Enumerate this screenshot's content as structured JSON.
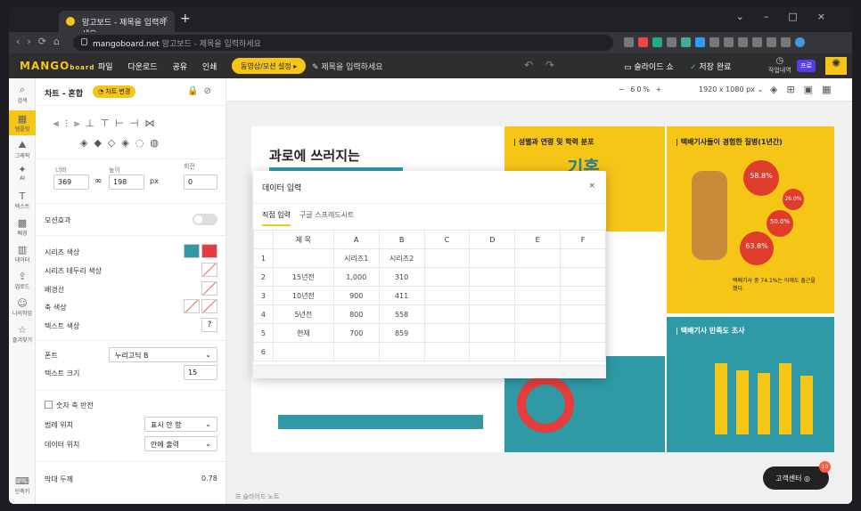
{
  "browser": {
    "tab_title": "망고보드 - 제목을 입력하세요",
    "url_host": "mangoboard.net",
    "url_rest": "망고보드 - 제목을 입력하세요"
  },
  "app": {
    "logo": "MANGO",
    "logo_sub": "board",
    "menus": [
      "파일",
      "다운로드",
      "공유",
      "인쇄"
    ],
    "video_pill": "동영상/모션 설정 ▸",
    "doc_title_placeholder": "제목을 입력하세요",
    "slideshow": "슬라이드 쇼",
    "save_status": "저장 완료",
    "history": "작업내역",
    "pro": "프로"
  },
  "rail": [
    {
      "icon": "⌕",
      "label": "검색"
    },
    {
      "icon": "▦",
      "label": "템플릿"
    },
    {
      "icon": "⛰",
      "label": "그래픽"
    },
    {
      "icon": "✦",
      "label": "AI"
    },
    {
      "icon": "T",
      "label": "텍스트"
    },
    {
      "icon": "▩",
      "label": "배경"
    },
    {
      "icon": "▥",
      "label": "데이터"
    },
    {
      "icon": "⇪",
      "label": "업로드"
    },
    {
      "icon": "☺",
      "label": "나의작업"
    },
    {
      "icon": "☆",
      "label": "즐겨찾기"
    },
    {
      "icon": "⌨",
      "label": "단축키"
    }
  ],
  "panel": {
    "title": "차트 - 혼합",
    "change_chart": "차트 변경",
    "width_label": "너비",
    "width": "369",
    "height_label": "높이",
    "height": "198",
    "unit": "px",
    "rotate_label": "회전",
    "rotate": "0",
    "motion": "모션효과",
    "series_color": "시리즈 색상",
    "series_border": "시리즈 테두리 색상",
    "bg_color": "배경선",
    "axis_color": "축 색상",
    "text_color": "텍스트 색상",
    "font_label": "폰트",
    "font_value": "누리고딕 B",
    "text_size_label": "텍스트 크기",
    "text_size": "15",
    "swap_axis": "숫자 축 반전",
    "legend_pos_label": "범례 위치",
    "legend_pos": "표시 안 함",
    "data_pos_label": "데이터 위치",
    "data_pos": "안에 출력",
    "bar_thickness_label": "막대 두께",
    "bar_thickness": "0.78",
    "colors": {
      "series1": "#2f9aa6",
      "series2": "#e63c3c"
    }
  },
  "workspace": {
    "zoom": "60%",
    "canvas_size": "1920 x 1080 px",
    "notes": "슬라이드 노트"
  },
  "slide": {
    "title_line": "과로에 쓰러지는",
    "block1_title": "| 성별과 연령 및 학력 분포",
    "block1_big": "기혼",
    "block2_title": "| 택배기사들이 경험한 질병(1년간)",
    "stat1": "58.8%",
    "stat2": "26.0%",
    "stat3": "50.0%",
    "stat4": "63.8%",
    "block2_caption": "택배기사 중 74.1%는 어깨도 출근을 했다.",
    "block3_title": "| 택배기사 만족도 조사",
    "bars": [
      "2.88",
      "2.58",
      "2.48",
      "2.88",
      "2.38"
    ]
  },
  "dialog": {
    "title": "데이터 입력",
    "close": "×",
    "tab_direct": "직접 입력",
    "tab_sheet": "구글 스프레드시트",
    "columns": [
      "",
      "제 목",
      "A",
      "B",
      "C",
      "D",
      "E",
      "F"
    ],
    "rows": [
      [
        "1",
        "",
        "시리즈1",
        "시리즈2",
        "",
        "",
        "",
        ""
      ],
      [
        "2",
        "15년전",
        "1,000",
        "310",
        "",
        "",
        "",
        ""
      ],
      [
        "3",
        "10년전",
        "900",
        "411",
        "",
        "",
        "",
        ""
      ],
      [
        "4",
        "5년전",
        "800",
        "558",
        "",
        "",
        "",
        ""
      ],
      [
        "5",
        "현재",
        "700",
        "859",
        "",
        "",
        "",
        ""
      ],
      [
        "6",
        "",
        "",
        "",
        "",
        "",
        "",
        ""
      ]
    ]
  },
  "support": {
    "label": "고객센터",
    "badge": "10"
  }
}
